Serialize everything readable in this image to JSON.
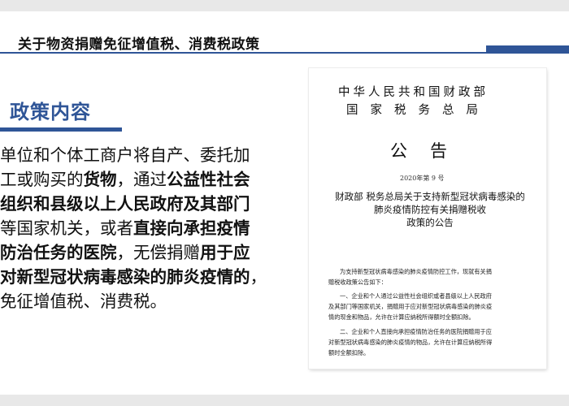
{
  "header": {
    "title": "关于物资捐赠免征增值税、消费税政策"
  },
  "section": {
    "title": "政策内容"
  },
  "body": {
    "lines": [
      [
        {
          "text": "单位和个体工商户将自产、委托加",
          "bold": false
        }
      ],
      [
        {
          "text": "工或购买的",
          "bold": false
        },
        {
          "text": "货物",
          "bold": true
        },
        {
          "text": "，通过",
          "bold": false
        },
        {
          "text": "公益性社会",
          "bold": true
        }
      ],
      [
        {
          "text": "组织和县级以上人民政府及其部门",
          "bold": true
        }
      ],
      [
        {
          "text": "等国家机关，或者",
          "bold": false
        },
        {
          "text": "直接向承担疫情",
          "bold": true
        }
      ],
      [
        {
          "text": "防治任务的医院",
          "bold": true
        },
        {
          "text": "，无偿捐赠",
          "bold": false
        },
        {
          "text": "用于应",
          "bold": true
        }
      ],
      [
        {
          "text": "对新型冠状病毒感染的肺炎疫情的",
          "bold": true
        },
        {
          "text": "，",
          "bold": false
        }
      ],
      [
        {
          "text": "免征增值税、消费税。",
          "bold": false
        }
      ]
    ]
  },
  "document": {
    "issuer_line1": "中华人民共和国财政部",
    "issuer_line2": "国家税务总局",
    "doc_type": "公告",
    "number": "2020年第 9 号",
    "subject_lines": [
      "财政部 税务总局关于支持新型冠状病毒感染的",
      "肺炎疫情防控有关捐赠税收",
      "政策的公告"
    ],
    "para_intro": [
      "为支持新型冠状病毒感染的肺炎疫情防控工作，现就有关捐",
      "赠税收政策公告如下："
    ],
    "para_1": [
      "一、企业和个人通过公益性社会组织或者县级以上人民政府",
      "及其部门等国家机关，捐赠用于应对新型冠状病毒感染的肺炎疫",
      "情的现金和物品，允许在计算应纳税所得额时全额扣除。"
    ],
    "para_2": [
      "二、企业和个人直接向承担疫情防治任务的医院捐赠用于应",
      "对新型冠状病毒感染的肺炎疫情的物品，允许在计算应纳税所得",
      "额时全额扣除。"
    ]
  }
}
